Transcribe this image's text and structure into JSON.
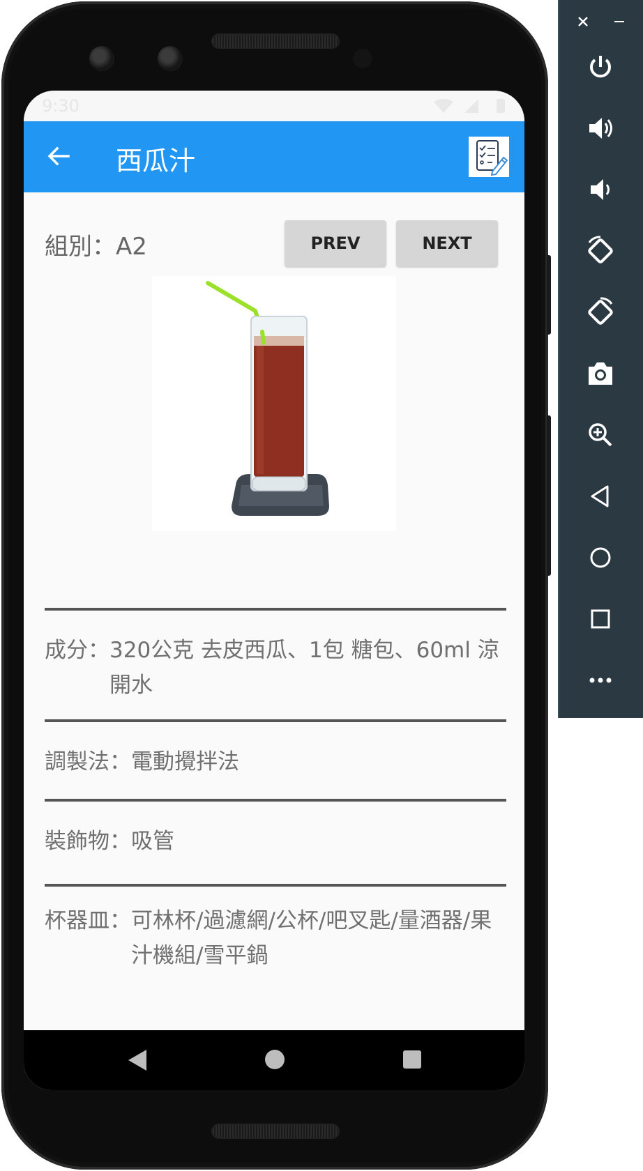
{
  "app_bar": {
    "title": "西瓜汁",
    "back_icon": "arrow-left-icon",
    "action_icon": "recipe-checklist-icon"
  },
  "status_bar": {
    "time": "9:30"
  },
  "group": {
    "label": "組別：A2"
  },
  "buttons": {
    "prev": "PREV",
    "next": "NEXT"
  },
  "image": {
    "subject": "watermelon-juice-glass"
  },
  "details": {
    "ingredients_key": "成分：",
    "ingredients_value": "320公克 去皮西瓜、1包 糖包、60ml 涼開水",
    "method_key": "調製法：",
    "method_value": "電動攪拌法",
    "garnish_key": "裝飾物：",
    "garnish_value": "吸管",
    "glassware_key": "杯器皿：",
    "glassware_value": "可林杯/過濾網/公杯/吧叉匙/量酒器/果汁機組/雪平鍋"
  },
  "colors": {
    "app_bar": "#2196f3",
    "button_bg": "#d6d6d6",
    "text": "#707070",
    "emulator_panel": "#2b3a42"
  },
  "emulator_toolbar": {
    "items": [
      "close-icon",
      "minimize-icon",
      "power-icon",
      "volume-up-icon",
      "volume-down-icon",
      "rotate-left-icon",
      "rotate-right-icon",
      "camera-icon",
      "zoom-icon",
      "back-icon",
      "home-icon",
      "overview-icon",
      "more-icon"
    ]
  }
}
